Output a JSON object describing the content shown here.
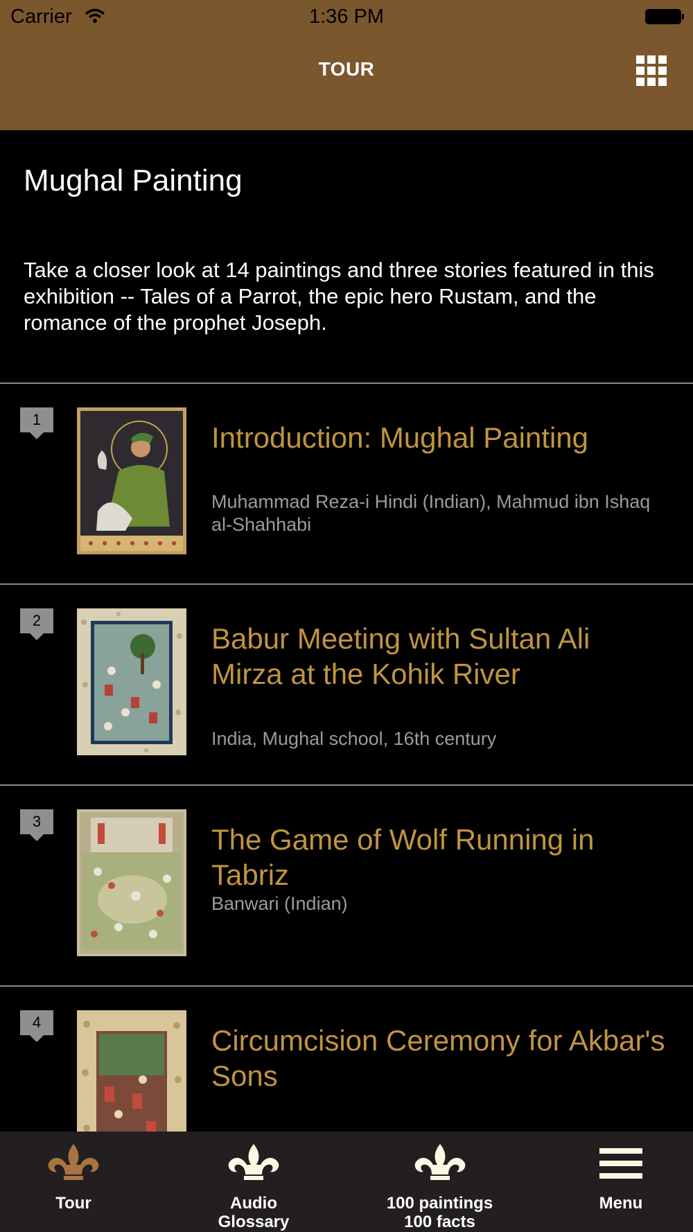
{
  "status_bar": {
    "carrier": "Carrier",
    "time": "1:36 PM"
  },
  "nav": {
    "title": "TOUR",
    "grid_icon": "grid-icon"
  },
  "intro": {
    "heading": "Mughal Painting",
    "description": "Take a closer look at 14 paintings and three stories featured in this exhibition -- Tales of a Parrot, the epic hero Rustam, and the romance of the prophet Joseph."
  },
  "items": [
    {
      "number": "1",
      "title": "Introduction: Mughal Painting",
      "subtitle": "Muhammad Reza-i Hindi (Indian), Mahmud ibn Ishaq al-Shahhabi"
    },
    {
      "number": "2",
      "title": "Babur Meeting with Sultan Ali Mirza at the Kohik River",
      "subtitle": "India, Mughal school, 16th century"
    },
    {
      "number": "3",
      "title": "The Game of Wolf Running in Tabriz",
      "subtitle": "Banwari (Indian)"
    },
    {
      "number": "4",
      "title": "Circumcision Ceremony for Akbar's Sons",
      "subtitle": ""
    }
  ],
  "tabs": [
    {
      "label": "Tour",
      "icon": "fleur-de-lis-icon",
      "active": true
    },
    {
      "label": "Audio Glossary",
      "icon": "fleur-de-lis-icon",
      "active": false
    },
    {
      "label": "100 paintings 100 facts",
      "icon": "fleur-de-lis-icon",
      "active": false
    },
    {
      "label": "Menu",
      "icon": "hamburger-menu-icon",
      "active": false
    }
  ],
  "colors": {
    "header_bg": "#7b572e",
    "title_gold": "#c09440",
    "tab_active": "#a87441",
    "tab_bg": "#231f20"
  }
}
